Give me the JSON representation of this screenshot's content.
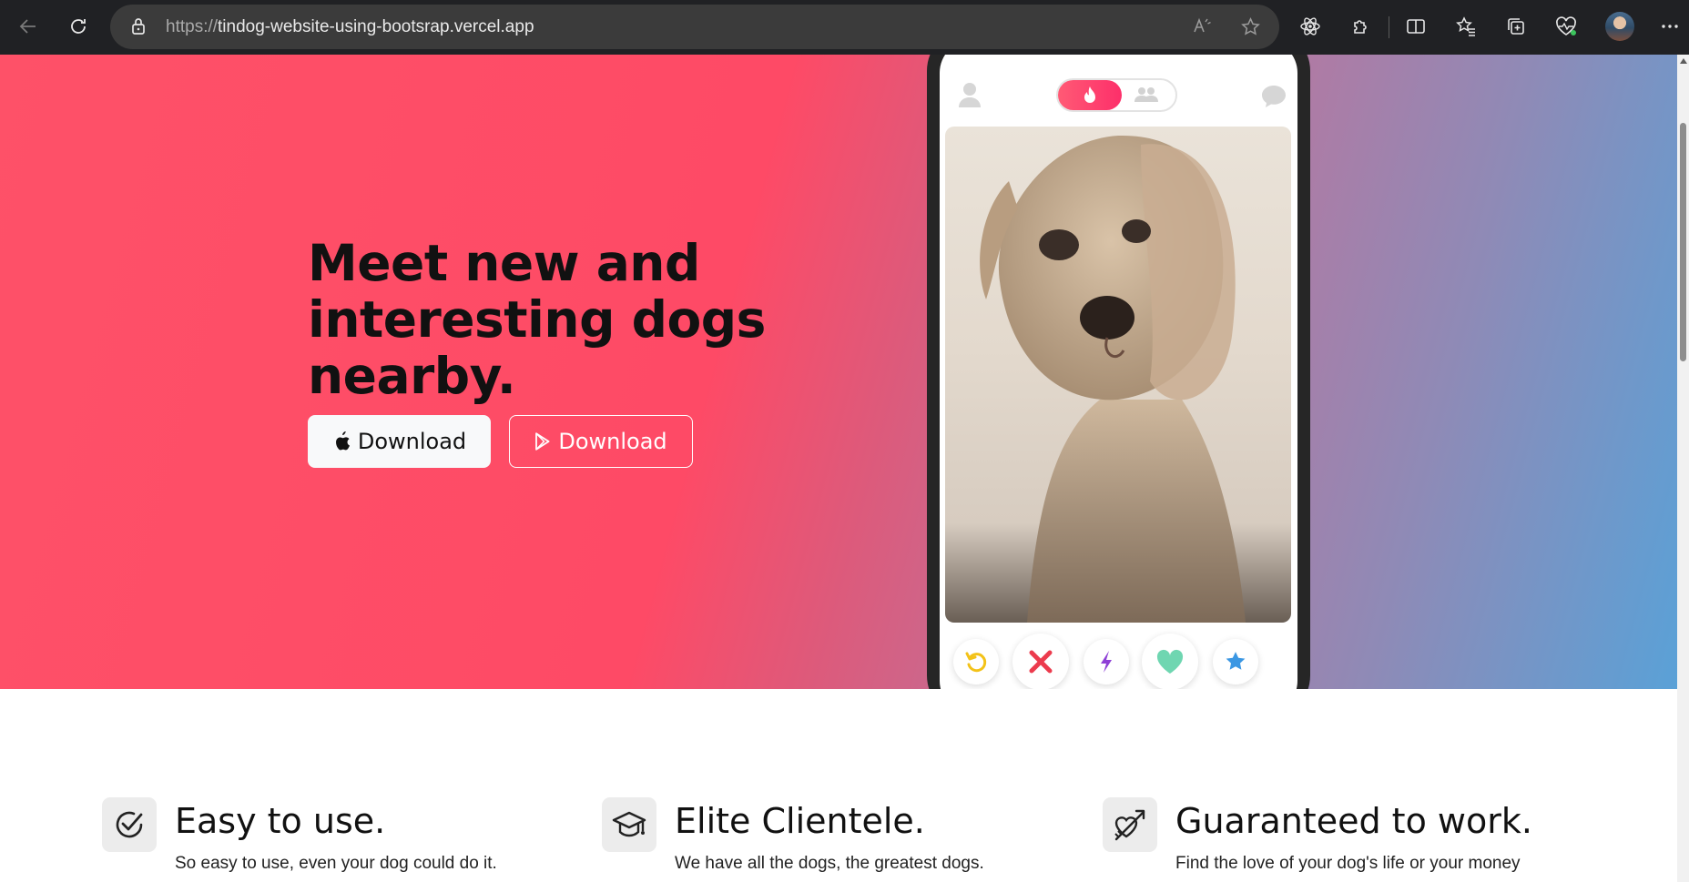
{
  "browser": {
    "url_scheme": "https://",
    "url_host": "tindog-website-using-bootsrap.vercel.app",
    "icons": [
      "back-icon",
      "refresh-icon",
      "lock-icon",
      "read-aloud-icon",
      "favorite-star-icon",
      "react-devtools-icon",
      "extensions-icon",
      "split-screen-icon",
      "favorites-icon",
      "collections-icon",
      "browser-essentials-icon",
      "profile-avatar",
      "more-icon"
    ]
  },
  "hero": {
    "title": "Meet new and interesting dogs nearby.",
    "download_apple": "Download",
    "download_play": "Download",
    "gradient": [
      "#fe5168",
      "#5aa1d7"
    ]
  },
  "phone": {
    "icons": [
      "user-icon",
      "flame-icon",
      "group-icon",
      "chat-icon",
      "rewind-icon",
      "nope-icon",
      "boost-icon",
      "like-icon",
      "super-like-icon"
    ],
    "colors": {
      "rewind": "#f3c218",
      "nope": "#ec3b4d",
      "boost": "#8e3fd6",
      "like": "#6fd6b1",
      "super_like": "#3b97e3"
    }
  },
  "features": [
    {
      "title": "Easy to use.",
      "text": "So easy to use, even your dog could do it.",
      "icon": "check-circle-icon"
    },
    {
      "title": "Elite Clientele.",
      "text": "We have all the dogs, the greatest dogs.",
      "icon": "graduation-cap-icon"
    },
    {
      "title": "Guaranteed to work.",
      "text": "Find the love of your dog's life or your money",
      "icon": "heart-arrow-icon"
    }
  ]
}
